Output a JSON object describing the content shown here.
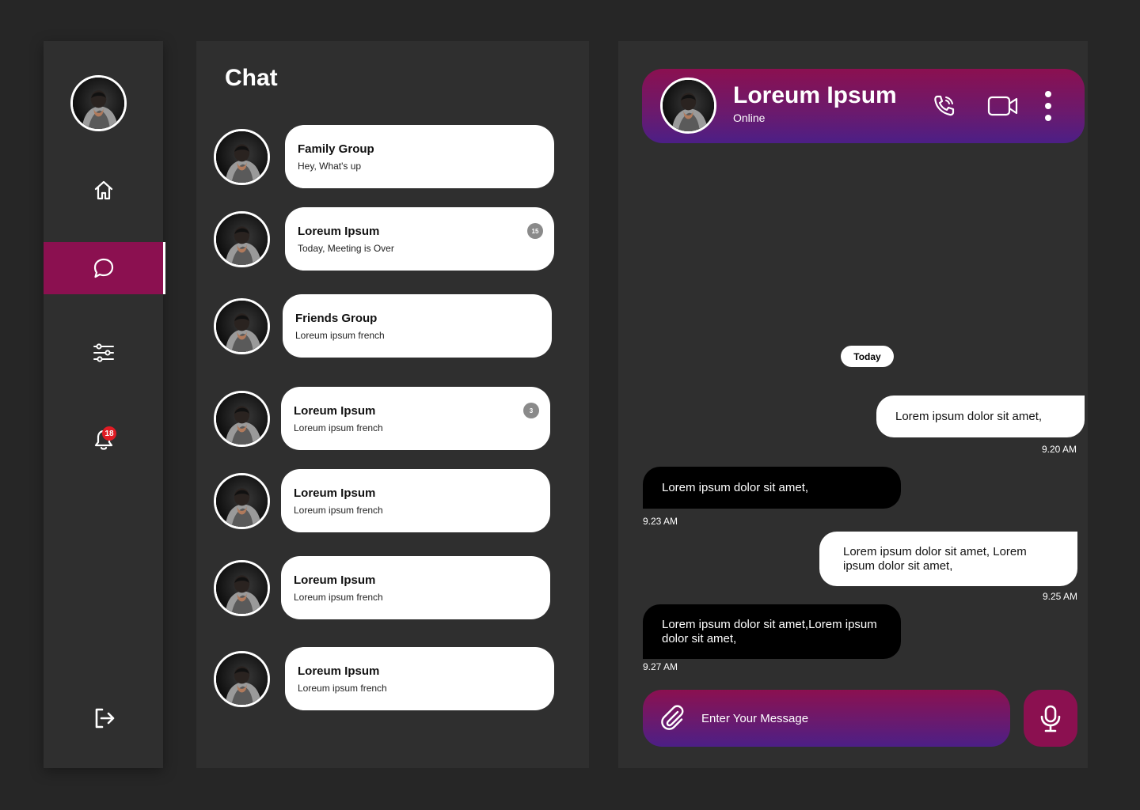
{
  "sidebar": {
    "items": [
      {
        "name": "home",
        "icon": "home-icon"
      },
      {
        "name": "chat",
        "icon": "chat-bubble-icon",
        "active": true
      },
      {
        "name": "settings",
        "icon": "sliders-icon"
      },
      {
        "name": "notifications",
        "icon": "bell-icon",
        "badge": "18"
      },
      {
        "name": "logout",
        "icon": "logout-icon"
      }
    ]
  },
  "chat_list": {
    "title": "Chat",
    "chats": [
      {
        "name": "Family Group",
        "preview": "Hey, What's up",
        "count": ""
      },
      {
        "name": "Loreum Ipsum",
        "preview": "Today, Meeting is Over",
        "count": "15"
      },
      {
        "name": "Friends Group",
        "preview": "Loreum ipsum french",
        "count": ""
      },
      {
        "name": "Loreum Ipsum",
        "preview": "Loreum ipsum french",
        "count": "3"
      },
      {
        "name": "Loreum Ipsum",
        "preview": "Loreum ipsum french",
        "count": ""
      },
      {
        "name": "Loreum Ipsum",
        "preview": "Loreum ipsum french",
        "count": ""
      },
      {
        "name": "Loreum Ipsum",
        "preview": "Loreum ipsum french",
        "count": ""
      }
    ]
  },
  "conversation": {
    "contact_name": "Loreum Ipsum",
    "status": "Online",
    "date_divider": "Today",
    "messages": [
      {
        "direction": "out",
        "text": "Lorem ipsum dolor sit amet,",
        "time": "9.20 AM"
      },
      {
        "direction": "in",
        "text": "Lorem ipsum dolor sit amet,",
        "time": "9.23 AM"
      },
      {
        "direction": "out",
        "text": "Lorem ipsum dolor sit amet, Lorem ipsum dolor sit amet,",
        "time": "9.25 AM"
      },
      {
        "direction": "in",
        "text": "Lorem ipsum dolor sit amet,Lorem ipsum dolor sit amet,",
        "time": "9.27 AM"
      }
    ],
    "composer": {
      "placeholder": "Enter Your Message"
    }
  },
  "colors": {
    "background": "#262626",
    "panel": "#2f2f2f",
    "accent": "#8b1050",
    "gradient_end": "#4c1f86",
    "badge_red": "#e01b24"
  }
}
